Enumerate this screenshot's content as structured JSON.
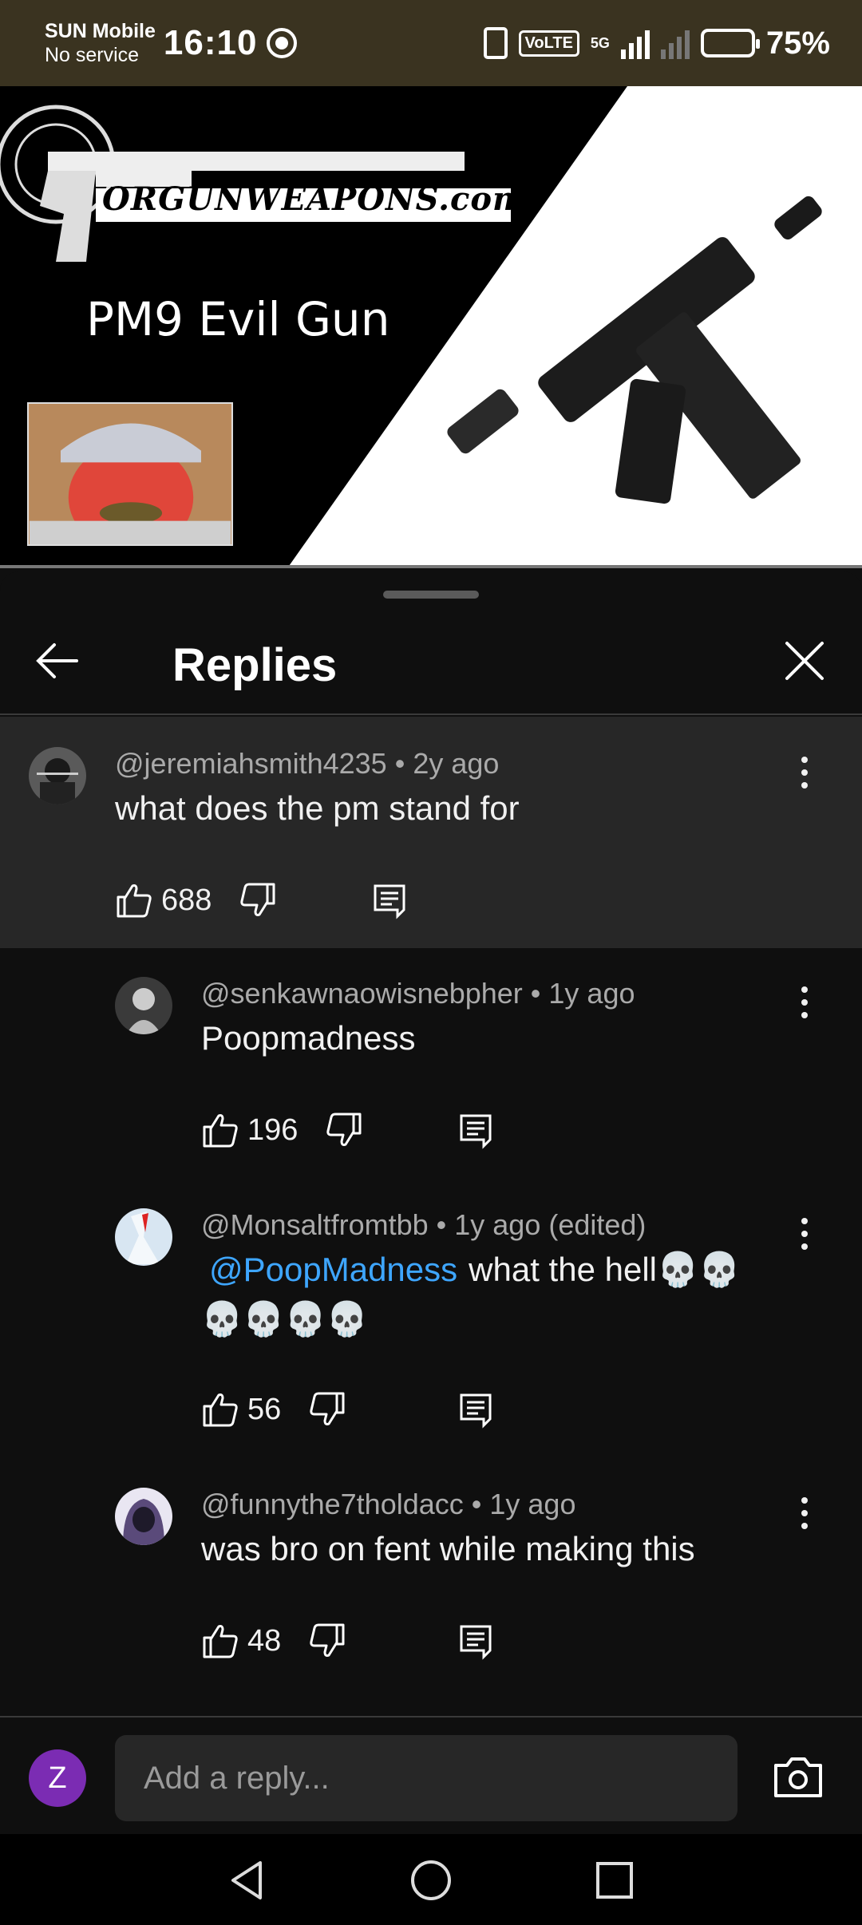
{
  "status_bar": {
    "carrier": "SUN Mobile",
    "service": "No service",
    "time": "16:10",
    "volte": "VoLTE",
    "network": "5G",
    "battery": "75%"
  },
  "video": {
    "logo_text": "ORGUNWEAPONS.com",
    "title": "PM9 Evil Gun"
  },
  "sheet": {
    "title": "Replies"
  },
  "parent_comment": {
    "author": "@jeremiahsmith4235",
    "age": "2y ago",
    "text": "what does the pm stand for",
    "likes": "688"
  },
  "replies": [
    {
      "author": "@senkawnaowisnebpher",
      "age": "1y ago",
      "text": "Poopmadness",
      "likes": "196"
    },
    {
      "author": "@Monsaltfromtbb",
      "age": "1y ago (edited)",
      "mention": "@PoopMadness",
      "text": "what the hell💀💀💀💀💀💀",
      "likes": "56"
    },
    {
      "author": "@funnythe7tholdacc",
      "age": "1y ago",
      "text": "was bro on fent while making this",
      "likes": "48"
    }
  ],
  "reply_bar": {
    "avatar_letter": "Z",
    "placeholder": "Add a reply..."
  },
  "meta_sep": " • "
}
